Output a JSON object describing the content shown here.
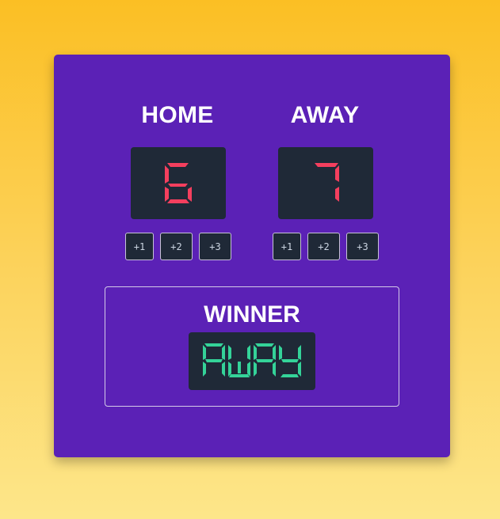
{
  "scoreboard": {
    "home": {
      "title": "HOME",
      "score": "6",
      "buttons": [
        "+1",
        "+2",
        "+3"
      ]
    },
    "away": {
      "title": "AWAY",
      "score": "7",
      "buttons": [
        "+1",
        "+2",
        "+3"
      ]
    },
    "winner": {
      "title": "WINNER",
      "value": "AWAY"
    }
  },
  "colors": {
    "card": "#5b21b6",
    "display": "#1f2937",
    "score_digits": "#f43f5e",
    "winner_text": "#34d399",
    "background_top": "#fbbf24",
    "background_bottom": "#fde68a"
  }
}
